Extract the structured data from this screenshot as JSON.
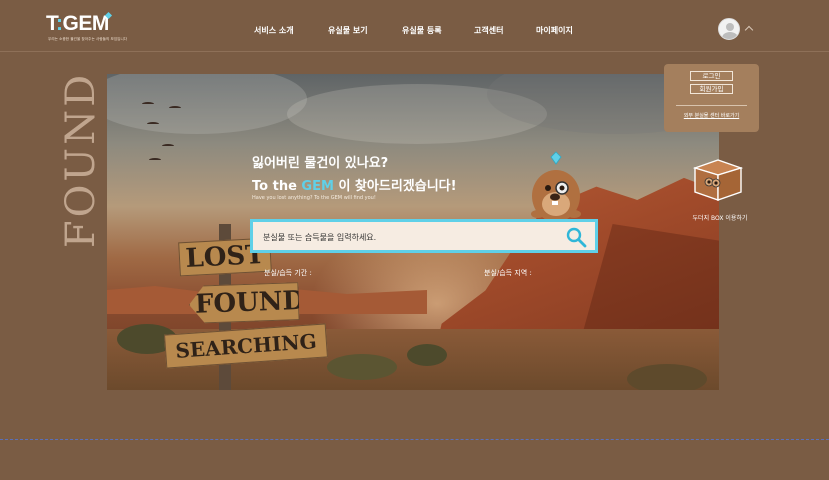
{
  "header": {
    "logo": {
      "text_prefix": "T",
      "text_suffix": "GEM",
      "tagline": "우리는 소중한 물건을 찾아주는 사람들의 모임입니다"
    },
    "nav": [
      {
        "label": "서비스 소개"
      },
      {
        "label": "유실물 보기"
      },
      {
        "label": "유실물 등록"
      },
      {
        "label": "고객센터"
      },
      {
        "label": "마이페이지"
      }
    ]
  },
  "side_text": "FOUND",
  "hero": {
    "title_line1": "잃어버린 물건이 있나요?",
    "title_line2_pre": "To the ",
    "title_line2_brand": "GEM",
    "title_line2_post": " 이 찾아드리겠습니다!",
    "subtitle": "Have you lost anything?  To the GEM will find you!",
    "search_placeholder": "분실물 또는 습득물을 입력하세요.",
    "filter_period_label": "분실/습득 기간 :",
    "filter_region_label": "분실/습득 지역 :",
    "signs": {
      "lost": "LOST",
      "found": "FOUND",
      "searching": "SEARCHING"
    }
  },
  "login_card": {
    "login_label": "로그인",
    "signup_label": "회원가입",
    "guest_link": "외부 분실물 센터 바로가기"
  },
  "box": {
    "label": "두더지 BOX 이용하기"
  },
  "colors": {
    "background": "#7a5c44",
    "accent": "#5fd0e8",
    "card": "#a47f5d"
  },
  "icons": [
    "search-icon",
    "user-avatar-icon",
    "chevron-up-icon",
    "gem-icon",
    "mole-mascot-icon",
    "mole-box-icon"
  ]
}
